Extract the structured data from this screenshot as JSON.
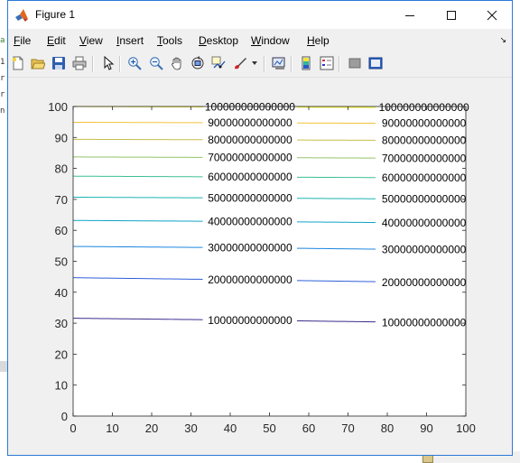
{
  "window": {
    "title": "Figure 1"
  },
  "menu": {
    "file": [
      "F",
      "ile"
    ],
    "edit": [
      "E",
      "dit"
    ],
    "view": [
      "V",
      "iew"
    ],
    "insert": [
      "I",
      "nsert"
    ],
    "tools": [
      "T",
      "ools"
    ],
    "desktop": [
      "D",
      "esktop"
    ],
    "window": [
      "W",
      "indow"
    ],
    "help": [
      "H",
      "elp"
    ]
  },
  "toolbar_icons": [
    "new-figure-icon",
    "open-file-icon",
    "save-icon",
    "print-icon",
    "pointer-icon",
    "zoom-in-icon",
    "zoom-out-icon",
    "pan-icon",
    "rotate-3d-icon",
    "data-cursor-icon",
    "brush-icon",
    "link-plot-icon",
    "insert-colorbar-icon",
    "insert-legend-icon",
    "hide-plot-tools-icon",
    "show-plot-tools-icon"
  ],
  "colors": {
    "plot_bg": "#ffffff",
    "figure_bg": "#f0f0f0",
    "window_border": "#2b79d6"
  },
  "background_code_chars": [
    "a",
    "1",
    "r",
    "r",
    "n"
  ],
  "chart_data": {
    "type": "contour",
    "xlim": [
      0,
      100
    ],
    "ylim": [
      0,
      100
    ],
    "xticks": [
      0,
      10,
      20,
      30,
      40,
      50,
      60,
      70,
      80,
      90,
      100
    ],
    "yticks": [
      0,
      10,
      20,
      30,
      40,
      50,
      60,
      70,
      80,
      90,
      100
    ],
    "grid": false,
    "colormap": "parula",
    "series": [
      {
        "level": "10000000000000",
        "label": "10000000000000",
        "y": [
          31.6,
          30.9,
          30.0
        ],
        "color": "#3e2a8c"
      },
      {
        "level": "20000000000000",
        "label": "20000000000000",
        "y": [
          44.7,
          43.9,
          43.0
        ],
        "color": "#2f5fd9"
      },
      {
        "level": "30000000000000",
        "label": "30000000000000",
        "y": [
          54.8,
          54.3,
          53.6
        ],
        "color": "#1c86e0"
      },
      {
        "level": "40000000000000",
        "label": "40000000000000",
        "y": [
          63.2,
          62.8,
          62.3
        ],
        "color": "#0fa4c6"
      },
      {
        "level": "50000000000000",
        "label": "50000000000000",
        "y": [
          70.7,
          70.4,
          70.0
        ],
        "color": "#1ab5b0"
      },
      {
        "level": "60000000000000",
        "label": "60000000000000",
        "y": [
          77.5,
          77.2,
          76.9
        ],
        "color": "#3dbf96"
      },
      {
        "level": "70000000000000",
        "label": "70000000000000",
        "y": [
          83.7,
          83.5,
          83.2
        ],
        "color": "#93c36a"
      },
      {
        "level": "80000000000000",
        "label": "80000000000000",
        "y": [
          89.4,
          89.2,
          89.0
        ],
        "color": "#c8bd4b"
      },
      {
        "level": "90000000000000",
        "label": "90000000000000",
        "y": [
          94.9,
          94.7,
          94.5
        ],
        "color": "#f3c23a"
      },
      {
        "level": "100000000000000",
        "label": "100000000000000",
        "y": [
          100.0,
          99.8,
          99.6
        ],
        "color": "#f9f21c"
      }
    ],
    "label_x": [
      45.5,
      89.8
    ]
  }
}
